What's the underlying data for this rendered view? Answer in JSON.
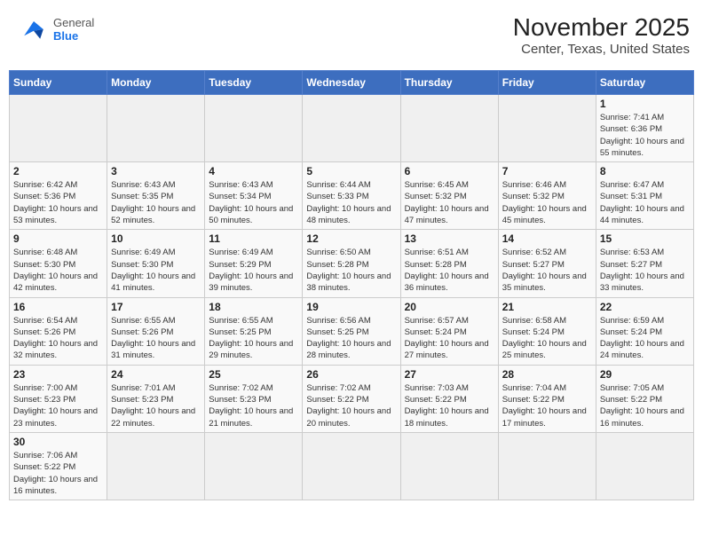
{
  "logo": {
    "text_general": "General",
    "text_blue": "Blue"
  },
  "title": "November 2025",
  "subtitle": "Center, Texas, United States",
  "weekdays": [
    "Sunday",
    "Monday",
    "Tuesday",
    "Wednesday",
    "Thursday",
    "Friday",
    "Saturday"
  ],
  "weeks": [
    [
      {
        "day": "",
        "info": ""
      },
      {
        "day": "",
        "info": ""
      },
      {
        "day": "",
        "info": ""
      },
      {
        "day": "",
        "info": ""
      },
      {
        "day": "",
        "info": ""
      },
      {
        "day": "",
        "info": ""
      },
      {
        "day": "1",
        "info": "Sunrise: 7:41 AM\nSunset: 6:36 PM\nDaylight: 10 hours\nand 55 minutes."
      }
    ],
    [
      {
        "day": "2",
        "info": "Sunrise: 6:42 AM\nSunset: 5:36 PM\nDaylight: 10 hours\nand 53 minutes."
      },
      {
        "day": "3",
        "info": "Sunrise: 6:43 AM\nSunset: 5:35 PM\nDaylight: 10 hours\nand 52 minutes."
      },
      {
        "day": "4",
        "info": "Sunrise: 6:43 AM\nSunset: 5:34 PM\nDaylight: 10 hours\nand 50 minutes."
      },
      {
        "day": "5",
        "info": "Sunrise: 6:44 AM\nSunset: 5:33 PM\nDaylight: 10 hours\nand 48 minutes."
      },
      {
        "day": "6",
        "info": "Sunrise: 6:45 AM\nSunset: 5:32 PM\nDaylight: 10 hours\nand 47 minutes."
      },
      {
        "day": "7",
        "info": "Sunrise: 6:46 AM\nSunset: 5:32 PM\nDaylight: 10 hours\nand 45 minutes."
      },
      {
        "day": "8",
        "info": "Sunrise: 6:47 AM\nSunset: 5:31 PM\nDaylight: 10 hours\nand 44 minutes."
      }
    ],
    [
      {
        "day": "9",
        "info": "Sunrise: 6:48 AM\nSunset: 5:30 PM\nDaylight: 10 hours\nand 42 minutes."
      },
      {
        "day": "10",
        "info": "Sunrise: 6:49 AM\nSunset: 5:30 PM\nDaylight: 10 hours\nand 41 minutes."
      },
      {
        "day": "11",
        "info": "Sunrise: 6:49 AM\nSunset: 5:29 PM\nDaylight: 10 hours\nand 39 minutes."
      },
      {
        "day": "12",
        "info": "Sunrise: 6:50 AM\nSunset: 5:28 PM\nDaylight: 10 hours\nand 38 minutes."
      },
      {
        "day": "13",
        "info": "Sunrise: 6:51 AM\nSunset: 5:28 PM\nDaylight: 10 hours\nand 36 minutes."
      },
      {
        "day": "14",
        "info": "Sunrise: 6:52 AM\nSunset: 5:27 PM\nDaylight: 10 hours\nand 35 minutes."
      },
      {
        "day": "15",
        "info": "Sunrise: 6:53 AM\nSunset: 5:27 PM\nDaylight: 10 hours\nand 33 minutes."
      }
    ],
    [
      {
        "day": "16",
        "info": "Sunrise: 6:54 AM\nSunset: 5:26 PM\nDaylight: 10 hours\nand 32 minutes."
      },
      {
        "day": "17",
        "info": "Sunrise: 6:55 AM\nSunset: 5:26 PM\nDaylight: 10 hours\nand 31 minutes."
      },
      {
        "day": "18",
        "info": "Sunrise: 6:55 AM\nSunset: 5:25 PM\nDaylight: 10 hours\nand 29 minutes."
      },
      {
        "day": "19",
        "info": "Sunrise: 6:56 AM\nSunset: 5:25 PM\nDaylight: 10 hours\nand 28 minutes."
      },
      {
        "day": "20",
        "info": "Sunrise: 6:57 AM\nSunset: 5:24 PM\nDaylight: 10 hours\nand 27 minutes."
      },
      {
        "day": "21",
        "info": "Sunrise: 6:58 AM\nSunset: 5:24 PM\nDaylight: 10 hours\nand 25 minutes."
      },
      {
        "day": "22",
        "info": "Sunrise: 6:59 AM\nSunset: 5:24 PM\nDaylight: 10 hours\nand 24 minutes."
      }
    ],
    [
      {
        "day": "23",
        "info": "Sunrise: 7:00 AM\nSunset: 5:23 PM\nDaylight: 10 hours\nand 23 minutes."
      },
      {
        "day": "24",
        "info": "Sunrise: 7:01 AM\nSunset: 5:23 PM\nDaylight: 10 hours\nand 22 minutes."
      },
      {
        "day": "25",
        "info": "Sunrise: 7:02 AM\nSunset: 5:23 PM\nDaylight: 10 hours\nand 21 minutes."
      },
      {
        "day": "26",
        "info": "Sunrise: 7:02 AM\nSunset: 5:22 PM\nDaylight: 10 hours\nand 20 minutes."
      },
      {
        "day": "27",
        "info": "Sunrise: 7:03 AM\nSunset: 5:22 PM\nDaylight: 10 hours\nand 18 minutes."
      },
      {
        "day": "28",
        "info": "Sunrise: 7:04 AM\nSunset: 5:22 PM\nDaylight: 10 hours\nand 17 minutes."
      },
      {
        "day": "29",
        "info": "Sunrise: 7:05 AM\nSunset: 5:22 PM\nDaylight: 10 hours\nand 16 minutes."
      }
    ],
    [
      {
        "day": "30",
        "info": "Sunrise: 7:06 AM\nSunset: 5:22 PM\nDaylight: 10 hours\nand 16 minutes."
      },
      {
        "day": "",
        "info": ""
      },
      {
        "day": "",
        "info": ""
      },
      {
        "day": "",
        "info": ""
      },
      {
        "day": "",
        "info": ""
      },
      {
        "day": "",
        "info": ""
      },
      {
        "day": "",
        "info": ""
      }
    ]
  ]
}
